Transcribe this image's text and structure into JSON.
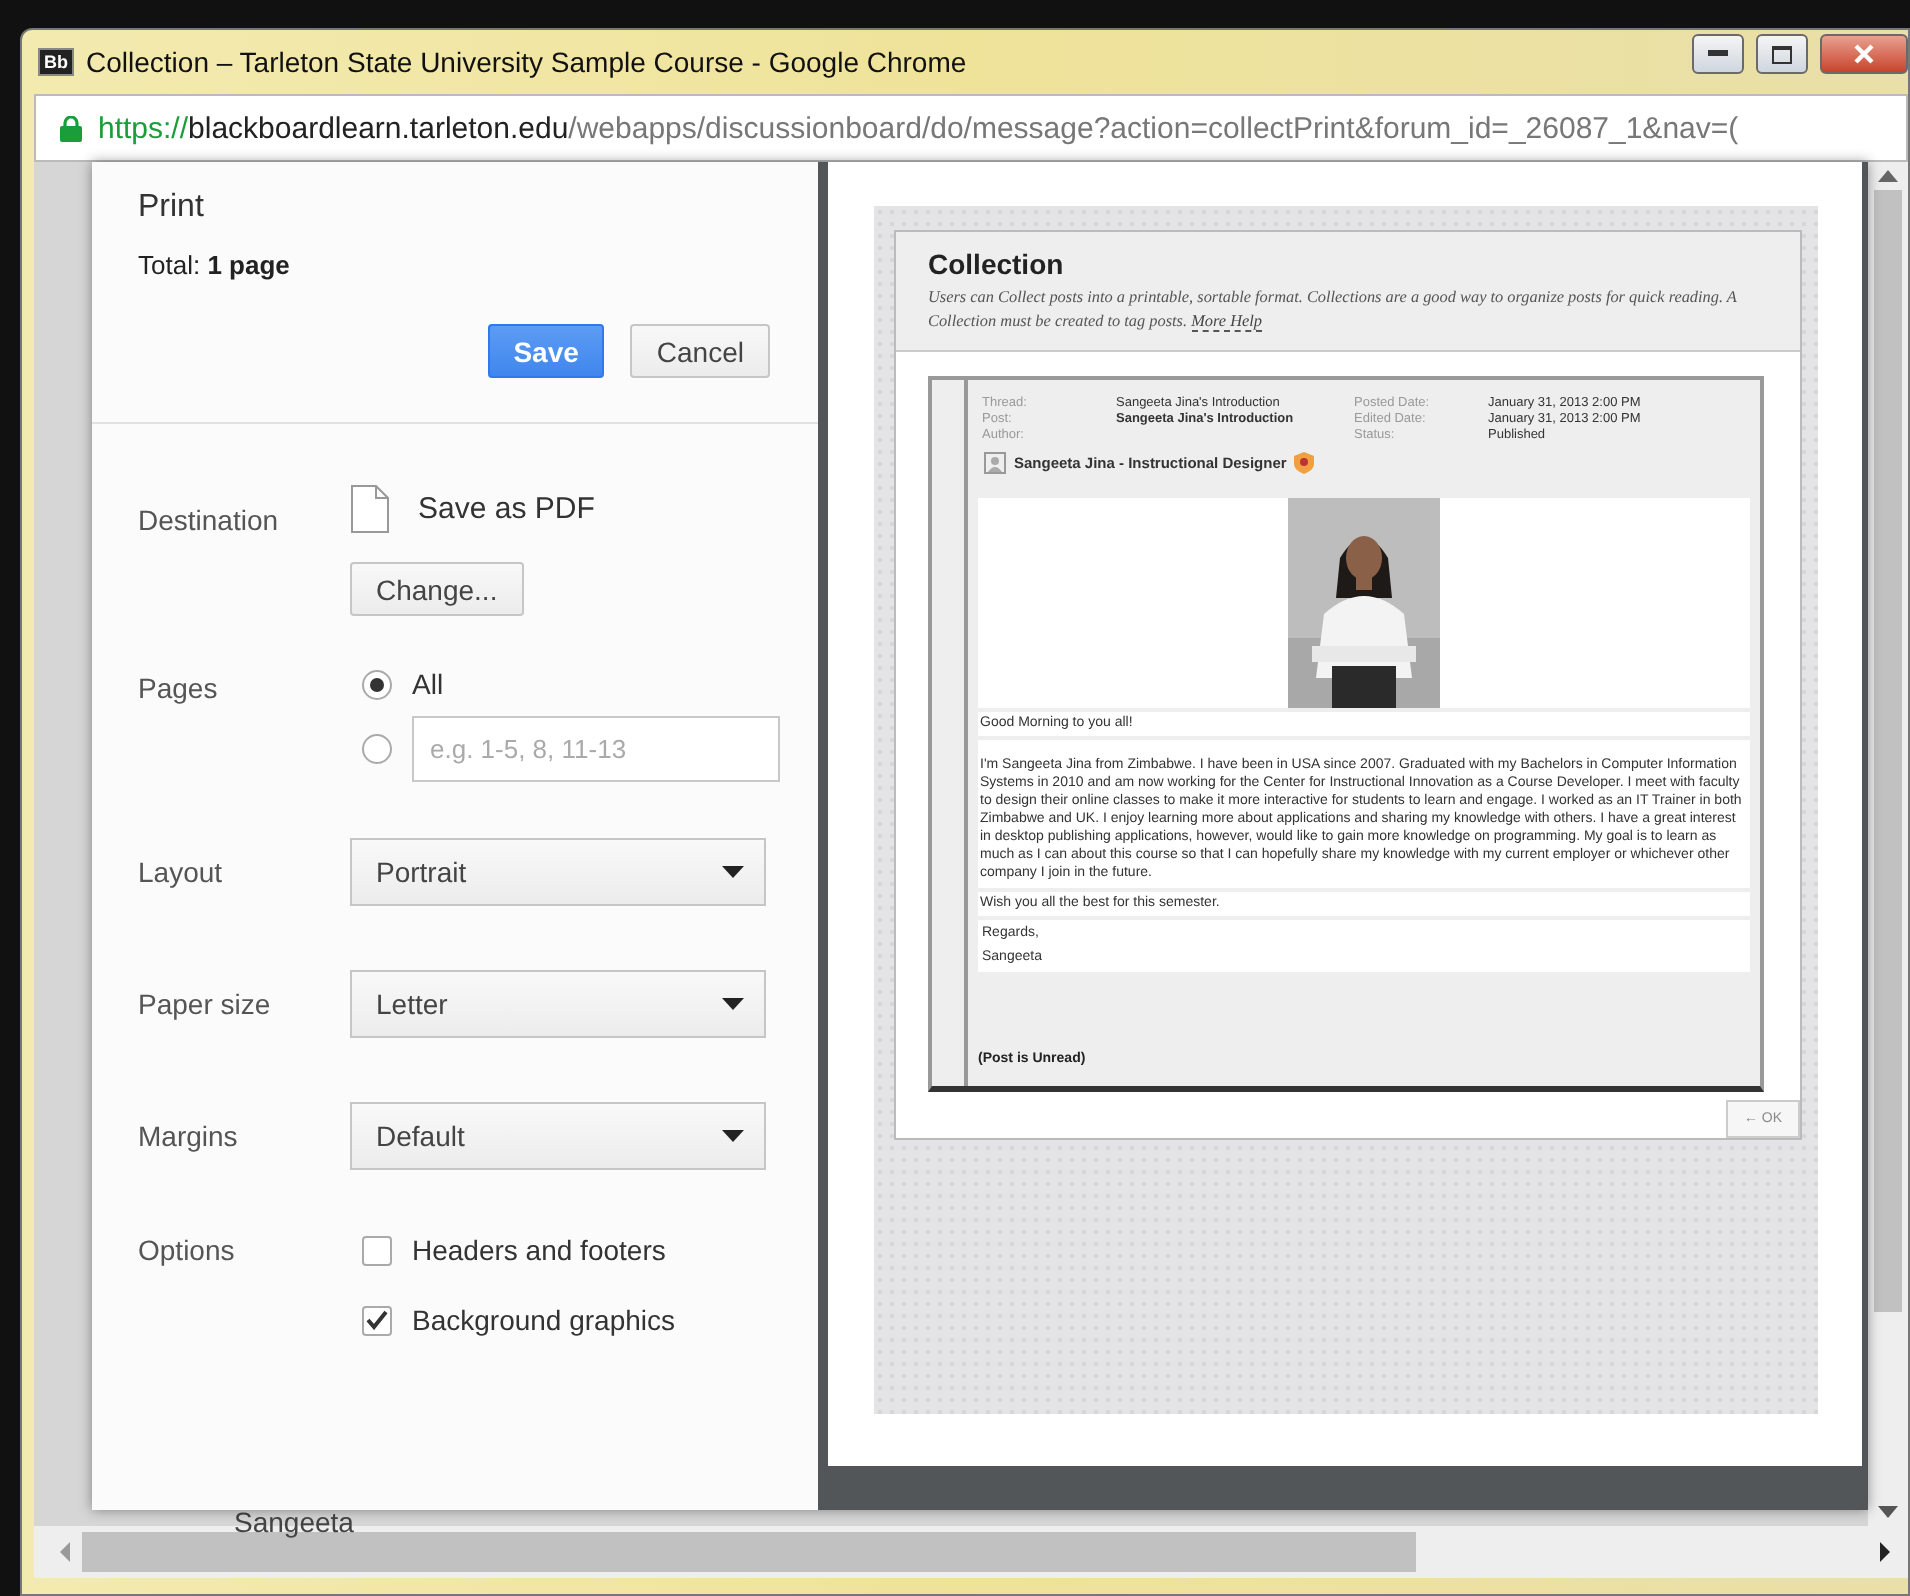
{
  "window": {
    "title": "Collection – Tarleton State University Sample Course - Google Chrome",
    "app_badge": "Bb"
  },
  "address_bar": {
    "scheme": "https://",
    "host": "blackboardlearn.tarleton.edu",
    "path": "/webapps/discussionboard/do/message?action=collectPrint&forum_id=_26087_1&nav=("
  },
  "background_page": {
    "text": "Sangeeta"
  },
  "print_panel": {
    "title": "Print",
    "total": "Total: **1 page**",
    "buttons": [
      {
        "label": "Save",
        "primary": true
      },
      {
        "label": "Cancel",
        "primary": false
      }
    ],
    "destination": {
      "label": "Destination",
      "value": "Save as PDF",
      "change_button": "Change..."
    },
    "pages": {
      "label": "Pages",
      "options": [
        {
          "kind": "label",
          "text": "All",
          "selected": true
        },
        {
          "kind": "field",
          "placeholder": "e.g. 1-5, 8, 11-13",
          "selected": false
        }
      ]
    },
    "selects": [
      {
        "label": "Layout",
        "value": "Portrait"
      },
      {
        "label": "Paper size",
        "value": "Letter"
      },
      {
        "label": "Margins",
        "value": "Default"
      }
    ],
    "options": {
      "label": "Options",
      "checkboxes": [
        {
          "text": "Headers and footers",
          "checked": false
        },
        {
          "text": "Background graphics",
          "checked": true
        }
      ]
    }
  },
  "preview": {
    "title": "Collection",
    "description": "Users can Collect posts into a printable, sortable format. Collections are a good way to organize posts for quick reading. A Collection must be created to tag posts.",
    "help_link": "More Help",
    "meta": [
      {
        "label": "Thread:",
        "value": "Sangeeta Jina's Introduction",
        "bold": false
      },
      {
        "label": "Posted Date:",
        "value": "January 31, 2013 2:00 PM",
        "bold": false
      },
      {
        "label": "Post:",
        "value": "Sangeeta Jina's Introduction",
        "bold": true
      },
      {
        "label": "Edited Date:",
        "value": "January 31, 2013 2:00 PM",
        "bold": false
      },
      {
        "label": "Author:"
      },
      {
        "label": "Status:",
        "value": "Published",
        "bold": false
      }
    ],
    "author": "Sangeeta Jina - Instructional Designer",
    "paragraphs": [
      "Good Morning to you all!",
      "I'm Sangeeta Jina from Zimbabwe.  I have been in USA since 2007.  Graduated with my Bachelors in Computer Information Systems in 2010 and am now working for the Center for Instructional Innovation as a Course Developer.  I meet with faculty to design their online classes to make it more interactive for students to learn and engage.  I worked as an IT Trainer in both Zimbabwe and UK.  I enjoy learning more about applications and sharing my knowledge with others.  I have a great interest in desktop publishing applications, however, would like to gain more knowledge on programming.    My goal is to learn as much as I can about this course so that I can hopefully share my knowledge with my current employer or whichever other company I join in the future.",
      "Wish you all the best for this semester."
    ],
    "closing": [
      "Regards,",
      "Sangeeta"
    ],
    "unread": "(Post is Unread)",
    "ok_button": "← OK"
  }
}
